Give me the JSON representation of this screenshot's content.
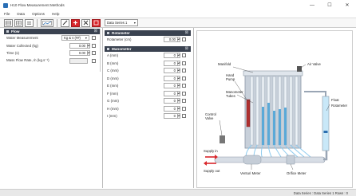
{
  "window": {
    "title": "H10 Flow Measurement Methods",
    "controls": [
      "—",
      "☐",
      "✕"
    ]
  },
  "menu": [
    "File",
    "Data",
    "Options",
    "Help"
  ],
  "toolbar": {
    "data_series": "Data Series 1"
  },
  "flow_pane": {
    "title": "Flow",
    "fields": [
      {
        "label": "Water Measurement",
        "value": "Kg & s (##)"
      },
      {
        "label": "Water Collected (kg)",
        "value": "0.00"
      },
      {
        "label": "Time (s)",
        "value": "0.00"
      },
      {
        "label": "Mass Flow Rate, ṁ (kg.s⁻¹)",
        "value": ""
      }
    ]
  },
  "rotameter_pane": {
    "title": "Rotameter",
    "fields": [
      {
        "label": "Rotameter (cm)",
        "value": "0.00"
      }
    ]
  },
  "manometer_pane": {
    "title": "Manometer",
    "fields": [
      {
        "label": "A (mm)",
        "value": "0"
      },
      {
        "label": "B (mm)",
        "value": "0"
      },
      {
        "label": "C (mm)",
        "value": "0"
      },
      {
        "label": "D (mm)",
        "value": "0"
      },
      {
        "label": "E (mm)",
        "value": "0"
      },
      {
        "label": "F (mm)",
        "value": "0"
      },
      {
        "label": "G (mm)",
        "value": "0"
      },
      {
        "label": "H (mm)",
        "value": "0"
      },
      {
        "label": "I (mm)",
        "value": "0"
      }
    ]
  },
  "diagram": {
    "labels": {
      "manifold": "Manifold",
      "air_valve": "Air Valve",
      "hand_pump": "Hand Pump",
      "manometer_tubes": "Manometer Tubes",
      "control_valve": "Control Valve",
      "float": "Float",
      "rotameter": "Rotameter",
      "supply_in": "Supply in",
      "supply_out": "Supply out",
      "venturi_meter": "Venturi Meter",
      "orifice_meter": "Orifice Meter"
    }
  },
  "status": {
    "text": "Data Series : Data Series 1   Rows : 0"
  }
}
